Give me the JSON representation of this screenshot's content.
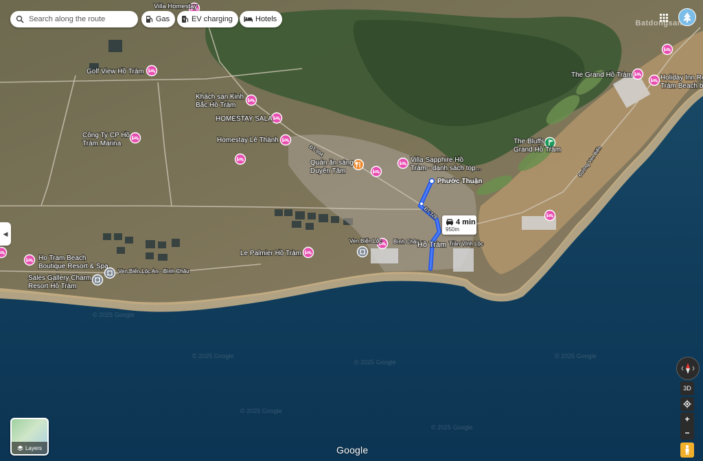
{
  "search": {
    "placeholder": "Search along the route"
  },
  "chips": [
    {
      "label": "Gas",
      "icon": "gas-station-icon"
    },
    {
      "label": "EV charging",
      "icon": "ev-charging-icon"
    },
    {
      "label": "Hotels",
      "icon": "bed-icon"
    }
  ],
  "watermark": "Batdongsan",
  "route": {
    "time": "4 min",
    "distance": "950m"
  },
  "controls": {
    "view_3d": "3D",
    "zoom_in": "+",
    "zoom_out": "−",
    "layers_label": "Layers"
  },
  "logo": "Google",
  "places": [
    {
      "lines": [
        "Villa Homestay"
      ],
      "pin": "hotel",
      "pin_color": "#e84fb1"
    },
    {
      "lines": [
        "Golf View Hồ Tràm"
      ],
      "pin": "hotel",
      "pin_color": "#e84fb1"
    },
    {
      "lines": [
        "Khách sạn Kinh",
        "Bắc Hồ Tràm"
      ],
      "pin": "hotel",
      "pin_color": "#e84fb1"
    },
    {
      "lines": [
        "HOMESTAY SALA"
      ],
      "pin": "hotel",
      "pin_color": "#e84fb1"
    },
    {
      "lines": [
        "Công Ty CP Hồ",
        "Tràm Marina"
      ],
      "pin": "hotel",
      "pin_color": "#e84fb1"
    },
    {
      "lines": [
        "Homestay Lê Thành"
      ],
      "pin": "hotel",
      "pin_color": "#e84fb1"
    },
    {
      "lines": [
        "Quán ăn sáng",
        "Duyên Tâm"
      ],
      "pin": "restaurant",
      "pin_color": "#ef8a2e"
    },
    {
      "lines": [
        "Villa Sapphire Hồ",
        "Tràm - danh sách top..."
      ],
      "pin": "hotel",
      "pin_color": "#e84fb1"
    },
    {
      "lines": [
        "The Grand Hồ Tràm"
      ],
      "pin": "hotel",
      "pin_color": "#e84fb1"
    },
    {
      "lines": [
        "Holiday Inn Re",
        "Tràm Beach b"
      ],
      "pin": "hotel",
      "pin_color": "#e84fb1"
    },
    {
      "lines": [
        "The Bluffs",
        "Grand Hồ Tràm"
      ],
      "pin": "golf",
      "pin_color": "#1e9a5a"
    },
    {
      "lines": [
        "Ho Tram Beach",
        "Boutique Resort & Spa"
      ],
      "pin": "hotel",
      "pin_color": "#e84fb1"
    },
    {
      "lines": [
        "Sales Gallery Charm",
        "Resort Hồ Tràm"
      ],
      "pin": "place",
      "pin_color": "#7d8793"
    },
    {
      "lines": [
        "Le Palmier Hồ Tràm"
      ],
      "pin": "hotel",
      "pin_color": "#e84fb1"
    },
    {
      "lines": [
        "Ven Biển Lộc An - Bình Châu"
      ],
      "pin": "none"
    },
    {
      "lines": [
        "Ven Biển Lộc"
      ],
      "pin": "hotel",
      "pin_color": "#e84fb1"
    },
    {
      "lines": [
        "Bình Châu"
      ],
      "pin": "none"
    },
    {
      "lines": [
        "Trần Vĩnh Lộc"
      ],
      "pin": "none"
    },
    {
      "lines": [
        "Phước Thuận"
      ],
      "pin": "dot"
    },
    {
      "lines": [
        "Hồ Tràm"
      ],
      "pin": "none"
    },
    {
      "lines": [
        "Đường Ven Biển"
      ],
      "pin": "none"
    },
    {
      "lines": [
        "ĐT 994"
      ],
      "pin": "none"
    },
    {
      "lines": [
        "ĐT 328"
      ],
      "pin": "none"
    }
  ],
  "copyrights": [
    "© 2025 Google",
    "© 2025 Google",
    "© 2025 Google",
    "© 2025 Google",
    "© 2025 Google",
    "© 2025 Google"
  ]
}
